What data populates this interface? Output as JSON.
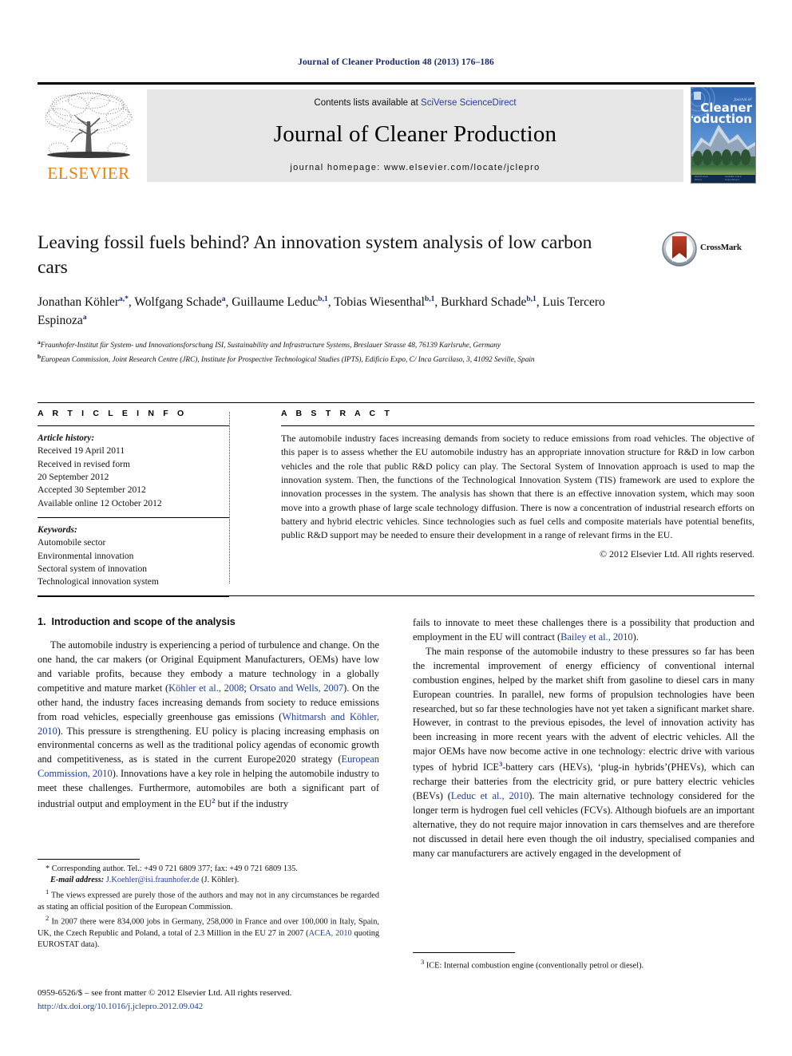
{
  "running_head": "Journal of Cleaner Production 48 (2013) 176–186",
  "masthead": {
    "publisher_name": "ELSEVIER",
    "contents_prefix": "Contents lists available at ",
    "contents_link": "SciVerse ScienceDirect",
    "journal_name": "Journal of Cleaner Production",
    "homepage": "journal homepage: www.elsevier.com/locate/jclepro",
    "cover_title_small": "Journal of",
    "cover_title_line1": "Cleaner",
    "cover_title_line2": "Production"
  },
  "article": {
    "title": "Leaving fossil fuels behind? An innovation system analysis of low carbon cars",
    "crossmark_label": "CrossMark",
    "authors_line1": "Jonathan Köhler",
    "authors": [
      {
        "name": "Jonathan Köhler",
        "sup": "a,*"
      },
      {
        "name": "Wolfgang Schade",
        "sup": "a"
      },
      {
        "name": "Guillaume Leduc",
        "sup": "b,1"
      },
      {
        "name": "Tobias Wiesenthal",
        "sup": "b,1"
      },
      {
        "name": "Burkhard Schade",
        "sup": "b,1"
      },
      {
        "name": "Luis Tercero Espinoza",
        "sup": "a"
      }
    ],
    "affiliations": [
      {
        "sup": "a",
        "text": "Fraunhofer-Institut für System- und Innovationsforschung ISI, Sustainability and Infrastructure Systems, Breslauer Strasse 48, 76139 Karlsruhe, Germany"
      },
      {
        "sup": "b",
        "text": "European Commission, Joint Research Centre (JRC), Institute for Prospective Technological Studies (IPTS), Edificio Expo, C/ Inca Garcilaso, 3, 41092 Seville, Spain"
      }
    ]
  },
  "article_info": {
    "heading": "A R T I C L E  I N F O",
    "history_label": "Article history:",
    "history": [
      "Received 19 April 2011",
      "Received in revised form",
      "20 September 2012",
      "Accepted 30 September 2012",
      "Available online 12 October 2012"
    ],
    "keywords_label": "Keywords:",
    "keywords": [
      "Automobile sector",
      "Environmental innovation",
      "Sectoral system of innovation",
      "Technological innovation system"
    ]
  },
  "abstract": {
    "heading": "A B S T R A C T",
    "text": "The automobile industry faces increasing demands from society to reduce emissions from road vehicles. The objective of this paper is to assess whether the EU automobile industry has an appropriate innovation structure for R&D in low carbon vehicles and the role that public R&D policy can play. The Sectoral System of Innovation approach is used to map the innovation system. Then, the functions of the Technological Innovation System (TIS) framework are used to explore the innovation processes in the system. The analysis has shown that there is an effective innovation system, which may soon move into a growth phase of large scale technology diffusion. There is now a concentration of industrial research efforts on battery and hybrid electric vehicles. Since technologies such as fuel cells and composite materials have potential benefits, public R&D support may be needed to ensure their development in a range of relevant firms in the EU.",
    "copyright": "© 2012 Elsevier Ltd. All rights reserved."
  },
  "body": {
    "section_number": "1.",
    "section_title": "Introduction and scope of the analysis",
    "left_paragraph_1_a": "The automobile industry is experiencing a period of turbulence and change. On the one hand, the car makers (or Original Equipment Manufacturers, OEMs) have low and variable profits, because they embody a mature technology in a globally competitive and mature market (",
    "left_ref_1": "Köhler et al., 2008",
    "left_sep_1": "; ",
    "left_ref_2": "Orsato and Wells, 2007",
    "left_paragraph_1_b": "). On the other hand, the industry faces increasing demands from society to reduce emissions from road vehicles, especially greenhouse gas emissions (",
    "left_ref_3": "Whitmarsh and Köhler, 2010",
    "left_paragraph_1_c": "). This pressure is strengthening. EU policy is placing increasing emphasis on environmental concerns as well as the traditional policy agendas of economic growth and competitiveness, as is stated in the current Europe2020 strategy (",
    "left_ref_4": "European Commission, 2010",
    "left_paragraph_1_d": "). Innovations have a key role in helping the automobile industry to meet these challenges. Furthermore, automobiles are both a significant part of industrial output and employment in the EU",
    "left_footnote_marker_2": "2",
    "left_paragraph_1_e": " but if the industry",
    "right_paragraph_1_a": "fails to innovate to meet these challenges there is a possibility that production and employment in the EU will contract (",
    "right_ref_1": "Bailey et al., 2010",
    "right_paragraph_1_b": ").",
    "right_paragraph_2_a": "The main response of the automobile industry to these pressures so far has been the incremental improvement of energy efficiency of conventional internal combustion engines, helped by the market shift from gasoline to diesel cars in many European countries. In parallel, new forms of propulsion technologies have been researched, but so far these technologies have not yet taken a significant market share. However, in contrast to the previous episodes, the level of innovation activity has been increasing in more recent years with the advent of electric vehicles. All the major OEMs have now become active in one technology: electric drive with various types of hybrid ICE",
    "right_footnote_marker_3": "3",
    "right_paragraph_2_b": "-battery cars (HEVs), ‘plug-in hybrids’(PHEVs), which can recharge their batteries from the electricity grid, or pure battery electric vehicles (BEVs) (",
    "right_ref_2": "Leduc et al., 2010",
    "right_paragraph_2_c": "). The main alternative technology considered for the longer term is hydrogen fuel cell vehicles (FCVs). Although biofuels are an important alternative, they do not require major innovation in cars themselves and are therefore not discussed in detail here even though the oil industry, specialised companies and many car manufacturers are actively engaged in the development of"
  },
  "footnotes": {
    "corresponding_marker": "*",
    "corresponding": "Corresponding author. Tel.: +49 0 721 6809 377; fax: +49 0 721 6809 135.",
    "email_label": "E-mail address:",
    "email": "J.Koehler@isi.fraunhofer.de",
    "email_suffix": " (J. Köhler).",
    "fn1_marker": "1",
    "fn1": "The views expressed are purely those of the authors and may not in any circumstances be regarded as stating an official position of the European Commission.",
    "fn2_marker": "2",
    "fn2_a": "In 2007 there were 834,000 jobs in Germany, 258,000 in France and over 100,000 in Italy, Spain, UK, the Czech Republic and Poland, a total of 2.3 Million in the EU 27 in 2007 (",
    "fn2_ref": "ACEA, 2010",
    "fn2_b": " quoting EUROSTAT data).",
    "fn3_marker": "3",
    "fn3": "ICE: Internal combustion engine (conventionally petrol or diesel)."
  },
  "issn": {
    "line": "0959-6526/$ – see front matter © 2012 Elsevier Ltd. All rights reserved.",
    "doi": "http://dx.doi.org/10.1016/j.jclepro.2012.09.042"
  },
  "colors": {
    "link": "#1f3d99",
    "running_head": "#1a2a66",
    "elsevier_orange": "#E8810C",
    "band_gray": "#e6e6e6"
  }
}
